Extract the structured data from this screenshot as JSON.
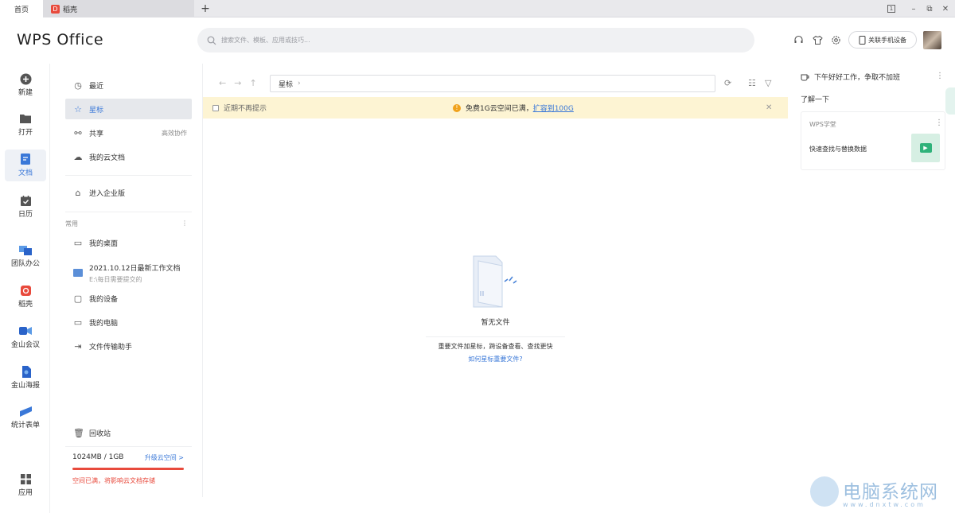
{
  "tabs": {
    "home": "首页",
    "doc": "稻壳",
    "doc_logo_letter": "D",
    "new_tab": "+"
  },
  "window": {
    "layout_icon": "1",
    "minimize": "–",
    "restore": "⧉",
    "close": "✕"
  },
  "brand": "WPS Office",
  "search": {
    "placeholder": "搜索文件、模板、应用或技巧..."
  },
  "header_icons": [
    "headset-icon",
    "shirt-icon",
    "settings-icon"
  ],
  "connect_device": "关联手机设备",
  "left_nav": [
    {
      "label": "新建",
      "icon": "plus-circle-icon"
    },
    {
      "label": "打开",
      "icon": "folder-icon"
    },
    {
      "label": "文档",
      "icon": "document-icon"
    },
    {
      "label": "日历",
      "icon": "calendar-icon"
    },
    {
      "label": "团队办公",
      "icon": "team-icon"
    },
    {
      "label": "稻壳",
      "icon": "docer-icon"
    },
    {
      "label": "金山会议",
      "icon": "meeting-icon"
    },
    {
      "label": "金山海报",
      "icon": "poster-icon"
    },
    {
      "label": "统计表单",
      "icon": "form-icon"
    },
    {
      "label": "应用",
      "icon": "apps-icon"
    }
  ],
  "sidebar": {
    "items": [
      {
        "label": "最近",
        "icon": "clock-icon"
      },
      {
        "label": "星标",
        "icon": "star-icon"
      },
      {
        "label": "共享",
        "icon": "share-icon",
        "extra": "高效协作"
      },
      {
        "label": "我的云文档",
        "icon": "cloud-icon"
      },
      {
        "label": "进入企业版",
        "icon": "enterprise-icon"
      }
    ],
    "common_title": "常用",
    "common_more": "⋮",
    "common": [
      {
        "label": "我的桌面",
        "icon": "desktop-icon"
      },
      {
        "label": "我的设备",
        "icon": "device-icon"
      },
      {
        "label": "我的电脑",
        "icon": "computer-icon"
      },
      {
        "label": "文件传输助手",
        "icon": "transfer-icon"
      }
    ],
    "folder": {
      "title": "2021.10.12日最新工作文档",
      "path": "E:\\每日需要提交的"
    },
    "recycle": "回收站",
    "storage": {
      "usage": "1024MB / 1GB",
      "upgrade": "升级云空间 >",
      "percent": 100,
      "warning": "空间已满，将影响云文档存储"
    }
  },
  "toolbar": {
    "back": "←",
    "forward": "→",
    "up": "↑",
    "path": "星标",
    "path_sep": "›",
    "refresh": "⟳",
    "view": "☷",
    "filter": "▽"
  },
  "notice": {
    "checkbox_label": "近期不再提示",
    "message": "免费1G云空间已满，",
    "link": "扩容到100G",
    "warn_symbol": "!",
    "close": "✕"
  },
  "empty": {
    "title": "暂无文件",
    "tip": "重要文件加星标，跨设备查看、查找更快",
    "link": "如何星标重要文件?"
  },
  "right_panel": {
    "greeting": "下午好好工作，争取不加班",
    "more": "⋮",
    "learn": "了解一下",
    "card": {
      "title": "WPS学堂",
      "text": "快速查找与替换数据",
      "more": "⋮",
      "play_symbol": "▶"
    }
  },
  "watermark": {
    "text": "电脑系统网",
    "url": "www.dnxtw.com"
  },
  "colors": {
    "accent": "#3a78d8",
    "danger": "#e84a3c",
    "notice_bg": "#fdf4d3",
    "warn": "#f0a21c"
  }
}
